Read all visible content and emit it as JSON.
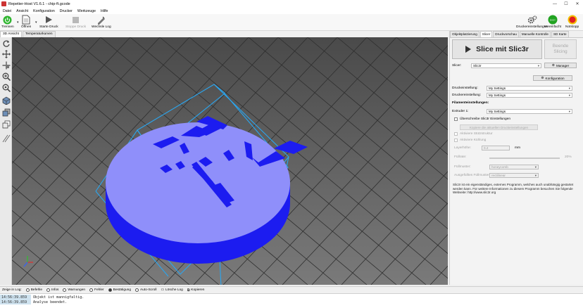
{
  "window": {
    "title": "Repetier-Host V1.6.1 - chip-ft.gcode"
  },
  "menu": [
    "Datei",
    "Ansicht",
    "Konfiguration",
    "Drucker",
    "Werkzeuge",
    "Hilfe"
  ],
  "toolbar": {
    "disconnect": "Trennen",
    "open": "Öffnen",
    "start_print": "Starte Druck",
    "stop_print": "Stoppe Druck",
    "toggle_log": "Wechsle Log",
    "printer_settings": "Druckereinstellungen",
    "easy_mode": "Vereinfacht",
    "emergency_stop": "Notstopp"
  },
  "view_tabs": [
    "3D Ansicht",
    "Temperaturkurven"
  ],
  "right_tabs": [
    "Objektplatzierung",
    "Slicer",
    "Druckvorschau",
    "Manuelle Kontrolle",
    "SD Karte"
  ],
  "slicer": {
    "slice_button": "Slice mit Slic3r",
    "kill_button_line1": "Beende",
    "kill_button_line2": "Slicing",
    "slicer_label": "Slicer:",
    "slicer_value": "Slic3r",
    "manager_button": "Manager",
    "config_button": "Konfiguration",
    "print_settings_label": "Druckeinstellung:",
    "print_settings_value": "My Settings",
    "printer_settings_label": "Druckereinstellung:",
    "printer_settings_value": "My Settings",
    "filament_header": "Filamenteinstellungen:",
    "extruder_label": "Extruder 1:",
    "extruder_value": "My Settings",
    "override_label": "Überschreibe Slic3r Einstellungen",
    "copy_button": "Kopiere die aktuellen Druckeinstellungen",
    "support_label": "Aktiviere Stützstruktur",
    "cooling_label": "Aktiviere Kühlung",
    "layer_height_label": "Layerhöhe:",
    "layer_height_value": "0.2",
    "layer_height_unit": "mm",
    "infill_density_label": "Füllrate:",
    "infill_density_value": "20%",
    "infill_pattern_label": "Füllmuster:",
    "infill_pattern_value": "honeycomb",
    "solid_infill_label": "Ausgefülltes Füllmuster:",
    "solid_infill_value": "rectilinear",
    "info_text": "Slic3r ist ein eigenständiges, externes Programm, welches auch unabhängig gestartet werden kann. Für weitere Informationen zu diesem Programm besuchen Sie folgende Webseite: http://www.slic3r.org"
  },
  "logbar": {
    "show_in_log": "Zeige in Log:",
    "commands": "Befehle",
    "infos": "Infos",
    "warnings": "Warnungen",
    "errors": "Fehler",
    "acks": "Bestätigung",
    "autoscroll": "Auto-Scroll",
    "clear_log": "Lösche Log",
    "copy": "Kopieren"
  },
  "log": [
    {
      "time": "14:56:39.859",
      "message": "Objekt ist mannigfaltig."
    },
    {
      "time": "14:56:39.859",
      "message": "Analyse beendet."
    }
  ],
  "colors": {
    "model_top": "#8f8ffa",
    "model_side": "#1c1cf0",
    "bbox": "#2aa6f0",
    "bed": "#555555"
  }
}
